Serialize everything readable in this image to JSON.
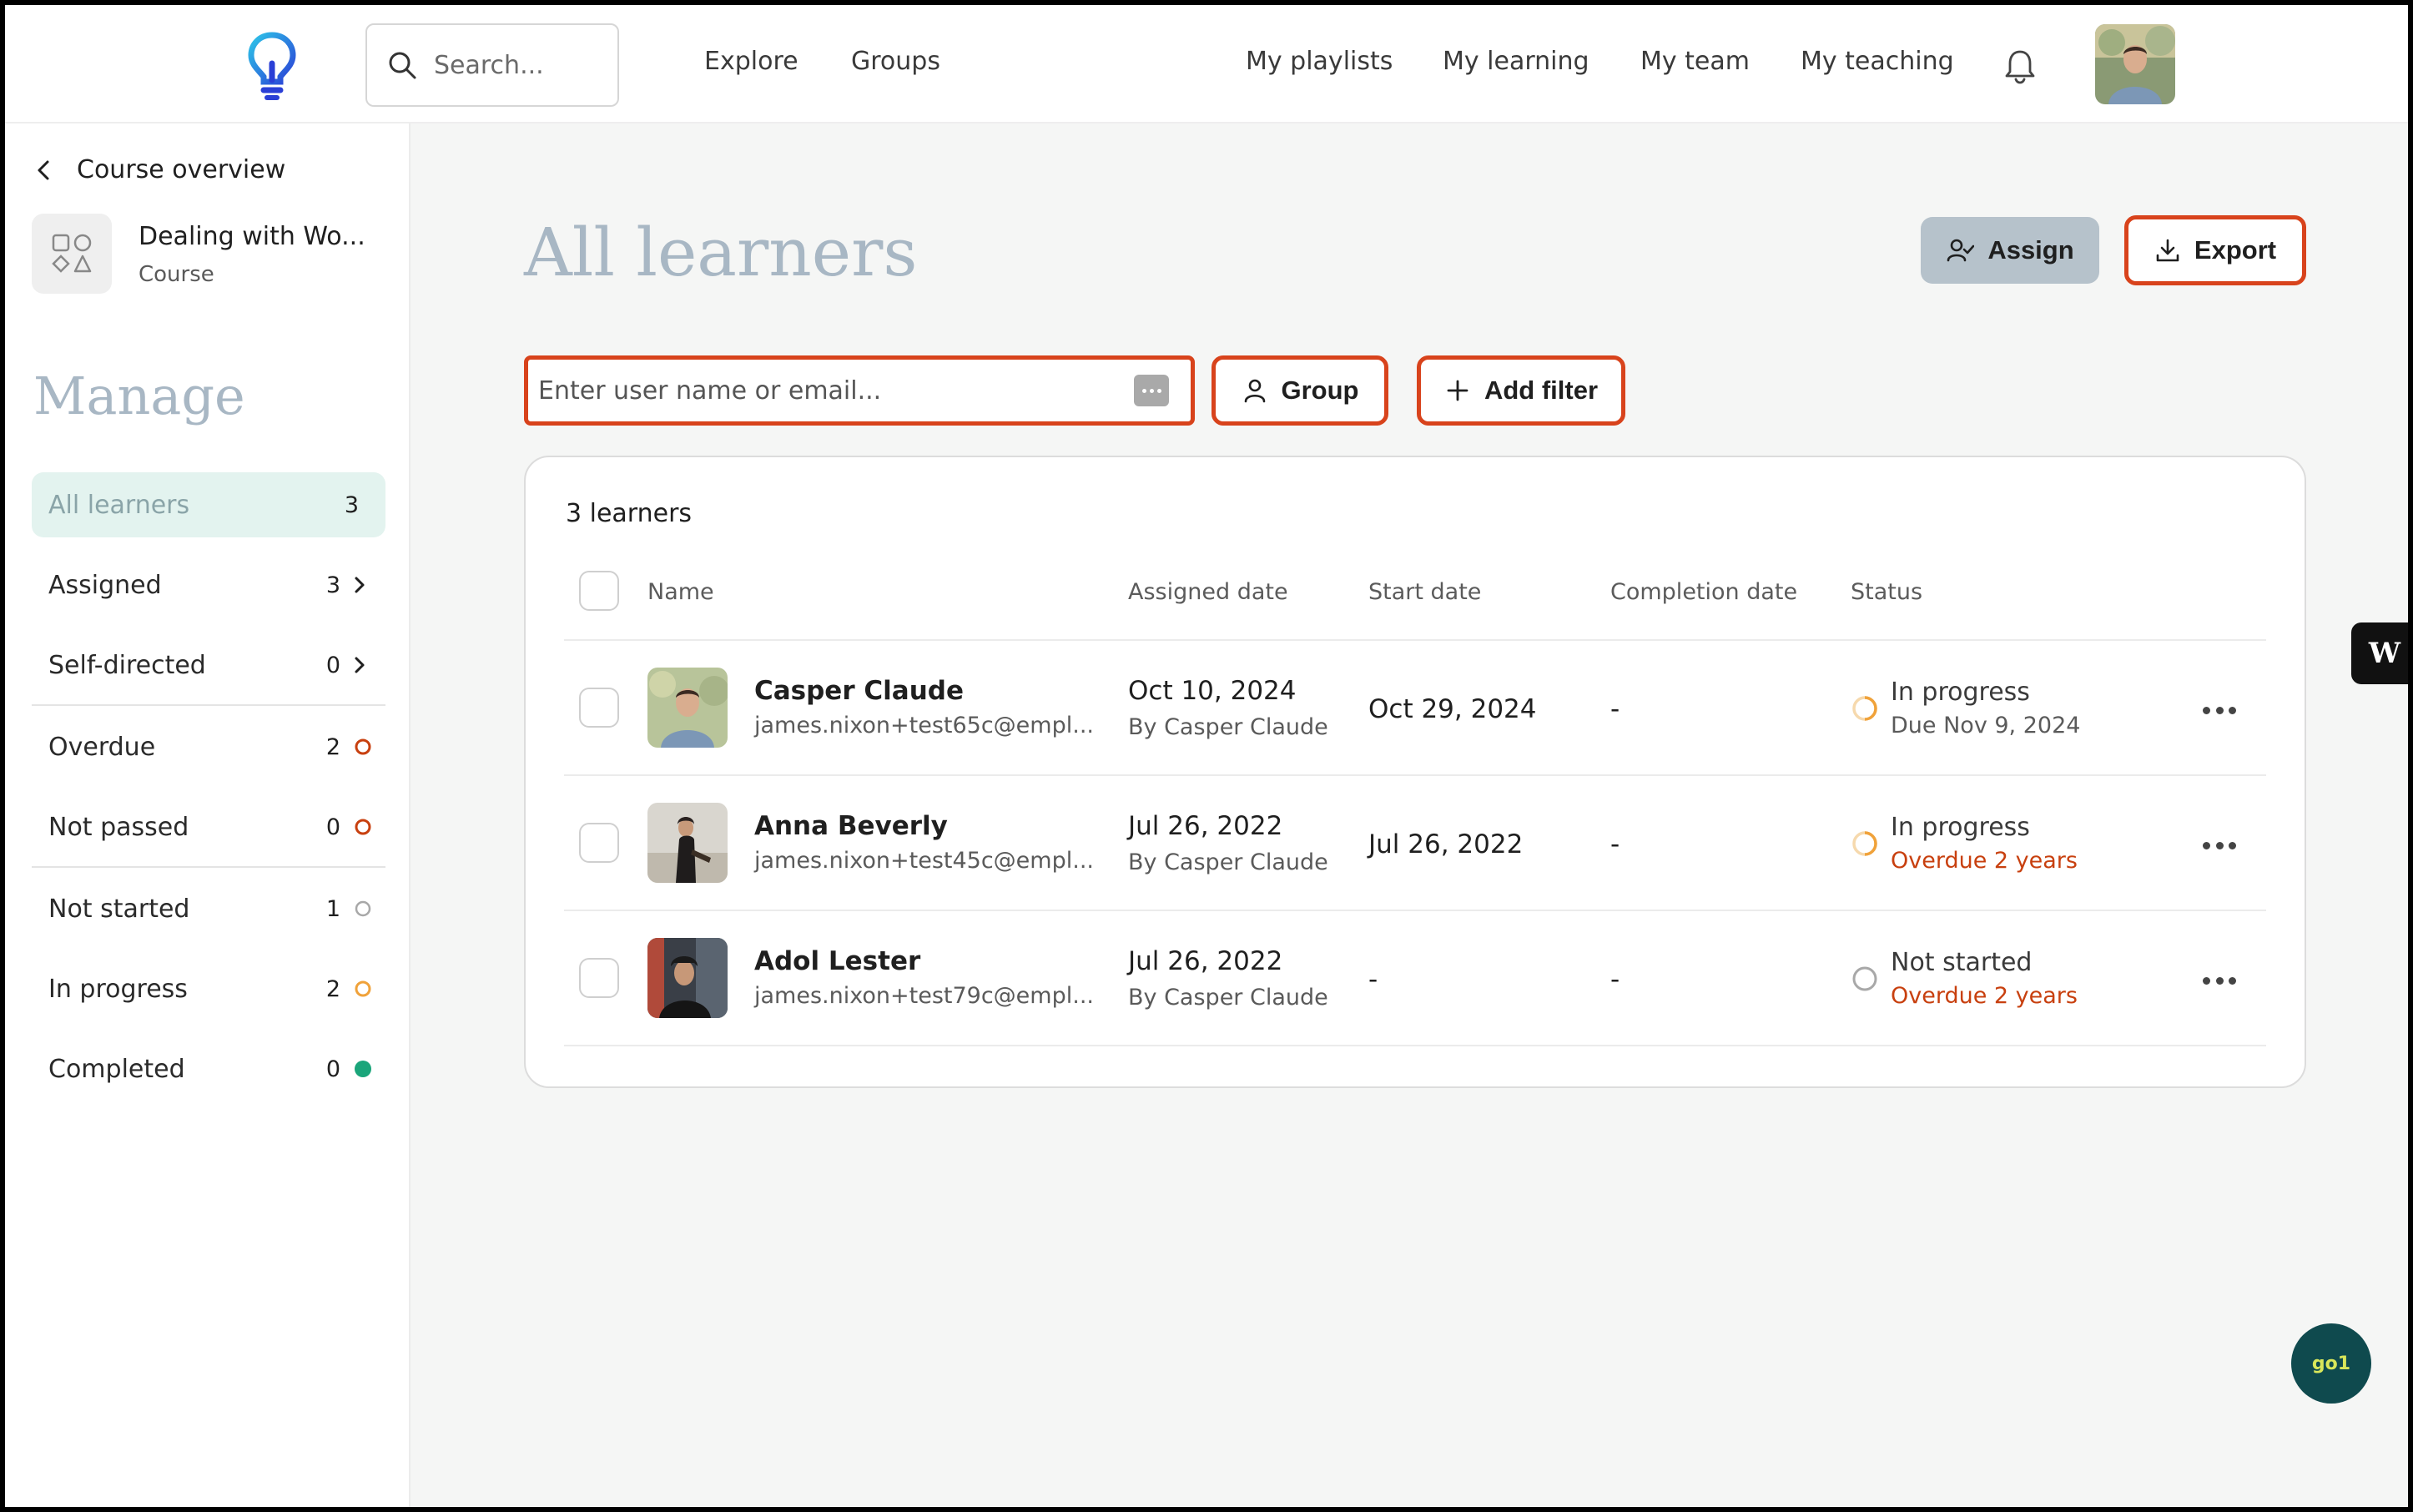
{
  "header": {
    "search_placeholder": "Search...",
    "nav_left": [
      "Explore",
      "Groups"
    ],
    "nav_right": [
      "My playlists",
      "My learning",
      "My team",
      "My teaching"
    ],
    "icons": [
      "lightbulb-logo-icon",
      "search-icon",
      "bell-icon",
      "user-avatar"
    ]
  },
  "sidebar": {
    "back_label": "Course overview",
    "course": {
      "name": "Dealing with Wo...",
      "type": "Course"
    },
    "manage_title": "Manage",
    "items": [
      {
        "label": "All learners",
        "count": "3",
        "marker": "none",
        "active": true
      },
      {
        "label": "Assigned",
        "count": "3",
        "marker": "chevron"
      },
      {
        "label": "Self-directed",
        "count": "0",
        "marker": "chevron"
      },
      {
        "label": "Overdue",
        "count": "2",
        "marker": "ring-red"
      },
      {
        "label": "Not passed",
        "count": "0",
        "marker": "ring-red"
      },
      {
        "label": "Not started",
        "count": "1",
        "marker": "ring-grey"
      },
      {
        "label": "In progress",
        "count": "2",
        "marker": "ring-orange"
      },
      {
        "label": "Completed",
        "count": "0",
        "marker": "dot-green"
      }
    ]
  },
  "main": {
    "title": "All learners",
    "assign_label": "Assign",
    "export_label": "Export",
    "filter_placeholder": "Enter user name or email...",
    "group_label": "Group",
    "add_filter_label": "Add filter",
    "learners_count": "3 learners",
    "columns": [
      "Name",
      "Assigned date",
      "Start date",
      "Completion date",
      "Status"
    ],
    "rows": [
      {
        "name": "Casper Claude",
        "email": "james.nixon+test65c@empl...",
        "assigned_date": "Oct 10, 2024",
        "assigned_by": "By Casper Claude",
        "start_date": "Oct 29, 2024",
        "completion_date": "-",
        "status": "In progress",
        "status_detail": "Due Nov 9, 2024",
        "status_detail_overdue": false
      },
      {
        "name": "Anna Beverly",
        "email": "james.nixon+test45c@empl...",
        "assigned_date": "Jul 26, 2022",
        "assigned_by": "By Casper Claude",
        "start_date": "Jul 26, 2022",
        "completion_date": "-",
        "status": "In progress",
        "status_detail": "Overdue 2 years",
        "status_detail_overdue": true
      },
      {
        "name": "Adol Lester",
        "email": "james.nixon+test79c@empl...",
        "assigned_date": "Jul 26, 2022",
        "assigned_by": "By Casper Claude",
        "start_date": "-",
        "completion_date": "-",
        "status": "Not started",
        "status_detail": "Overdue 2 years",
        "status_detail_overdue": true
      }
    ]
  },
  "widgets": {
    "side_tab_label": "W",
    "chat_label": "go1"
  },
  "colors": {
    "accent_red": "#d8431c",
    "title_grey": "#a8b7c4",
    "active_bg": "#e3f3ef",
    "progress_orange": "#f0a23a",
    "complete_green": "#1aa57a"
  }
}
